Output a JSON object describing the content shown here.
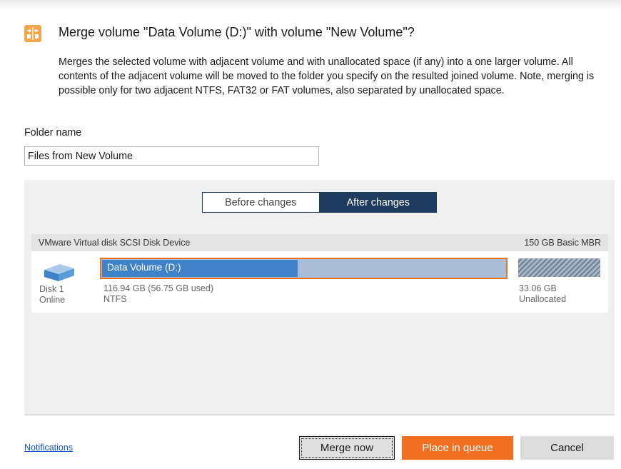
{
  "dialog": {
    "title": "Merge volume \"Data Volume (D:)\" with volume \"New Volume\"?",
    "description": "Merges the selected volume with adjacent volume and with unallocated space (if any) into a one larger volume. All contents of the adjacent volume will be moved to the folder you specify on the resulted joined volume. Note, merging is possible only for two adjacent NTFS, FAT32 or FAT volumes, also separated by unallocated space.",
    "header_icon": "merge-icon",
    "accent_color": "#f26f21"
  },
  "folder": {
    "label": "Folder name",
    "value": "Files from New Volume"
  },
  "preview": {
    "toggle": {
      "before_label": "Before changes",
      "after_label": "After changes",
      "selected": "After changes"
    },
    "disk": {
      "device_name": "VMware Virtual disk SCSI Disk Device",
      "summary": "150 GB Basic MBR",
      "disk_label": "Disk 1",
      "disk_status": "Online",
      "icon": "hard-disk-icon",
      "partition": {
        "name": "Data Volume (D:)",
        "size_text": "116.94 GB (56.75 GB used)",
        "filesystem": "NTFS",
        "used_fraction": 0.4853
      },
      "unallocated": {
        "size_text": "33.06 GB",
        "label": "Unallocated"
      }
    }
  },
  "footer": {
    "notifications_label": "Notifications",
    "merge_label": "Merge now",
    "queue_label": "Place in queue",
    "cancel_label": "Cancel"
  }
}
